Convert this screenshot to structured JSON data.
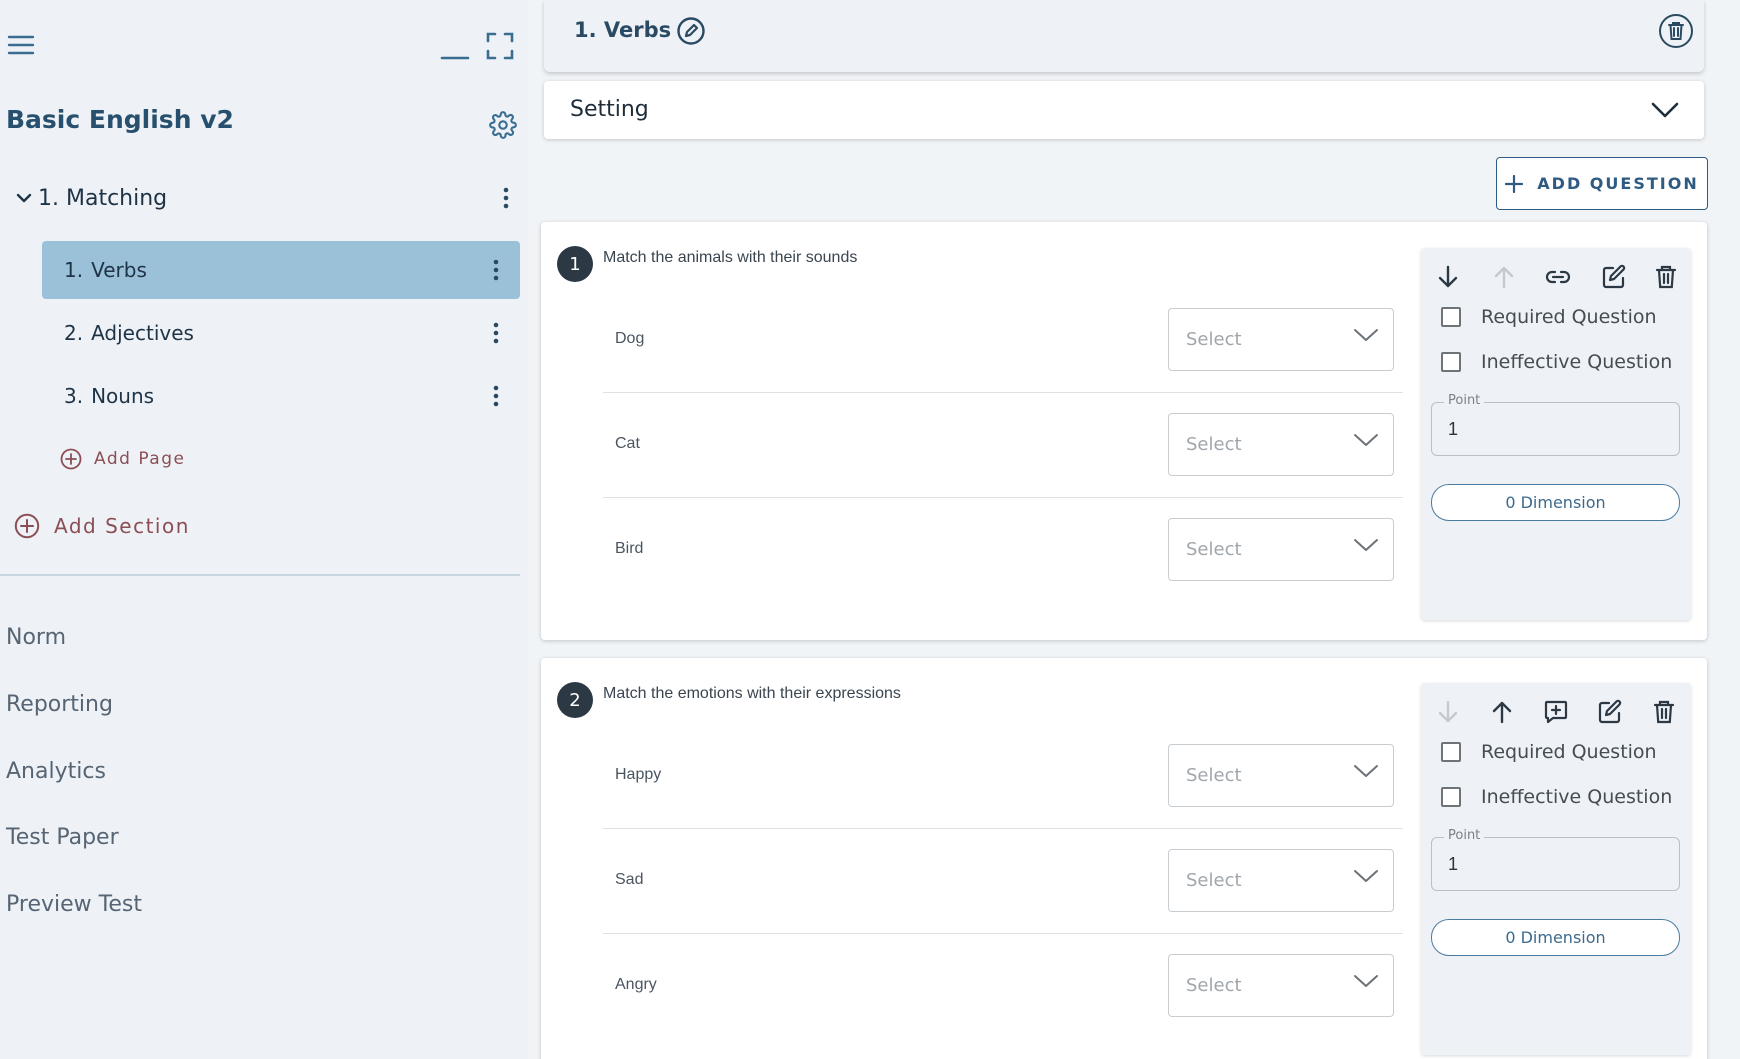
{
  "sidebar": {
    "course_title": "Basic English v2",
    "section": {
      "label": "1. Matching"
    },
    "pages": [
      {
        "number": "1.",
        "label": "Verbs",
        "active": true
      },
      {
        "number": "2.",
        "label": "Adjectives",
        "active": false
      },
      {
        "number": "3.",
        "label": "Nouns",
        "active": false
      }
    ],
    "add_page_label": "Add Page",
    "add_section_label": "Add Section",
    "nav": [
      {
        "label": "Norm"
      },
      {
        "label": "Reporting"
      },
      {
        "label": "Analytics"
      },
      {
        "label": "Test Paper"
      },
      {
        "label": "Preview Test"
      }
    ]
  },
  "header": {
    "title": "1. Verbs"
  },
  "setting": {
    "label": "Setting"
  },
  "toolbar": {
    "add_question_label": "ADD QUESTION"
  },
  "questions": [
    {
      "number": "1",
      "title": "Match the animals with their sounds",
      "rows": [
        {
          "label": "Dog",
          "select_placeholder": "Select"
        },
        {
          "label": "Cat",
          "select_placeholder": "Select"
        },
        {
          "label": "Bird",
          "select_placeholder": "Select"
        }
      ],
      "panel": {
        "required_label": "Required Question",
        "ineffective_label": "Ineffective Question",
        "point_label": "Point",
        "point_value": "1",
        "dimension_label": "0 Dimension"
      }
    },
    {
      "number": "2",
      "title": "Match the emotions with their expressions",
      "rows": [
        {
          "label": "Happy",
          "select_placeholder": "Select"
        },
        {
          "label": "Sad",
          "select_placeholder": "Select"
        },
        {
          "label": "Angry",
          "select_placeholder": "Select"
        }
      ],
      "panel": {
        "required_label": "Required Question",
        "ineffective_label": "Ineffective Question",
        "point_label": "Point",
        "point_value": "1",
        "dimension_label": "0 Dimension"
      }
    }
  ],
  "colors": {
    "accent": "#2f5b82",
    "active_page_bg": "#9bc1d8",
    "add_link": "#8b4e55",
    "badge": "#2c3945"
  }
}
